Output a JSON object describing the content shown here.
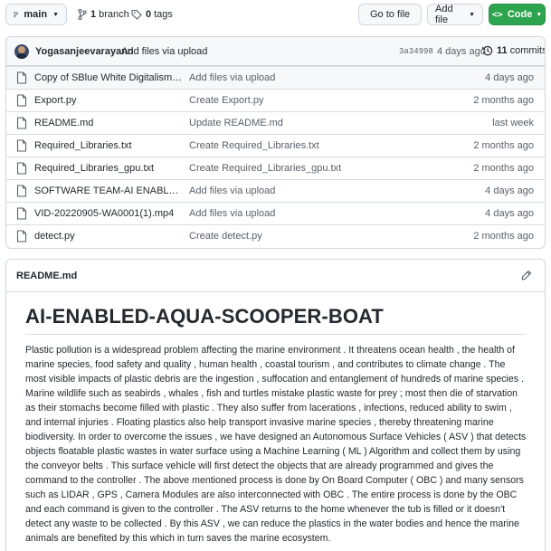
{
  "toolbar": {
    "branch": "main",
    "branches_count": "1",
    "branches_label": "branch",
    "tags_count": "0",
    "tags_label": "tags",
    "go_to_file": "Go to file",
    "add_file": "Add file",
    "code": "Code",
    "code_color": "#2da44e"
  },
  "latest_commit": {
    "author": "Yogasanjeevarayann",
    "message": "Add files via upload",
    "hash": "3a34998",
    "time": "4 days ago",
    "commits_count": "11",
    "commits_label": "commits"
  },
  "files": [
    {
      "name": "Copy of SBlue White Digitalism Basic ...",
      "commit": "Add files via upload",
      "age": "4 days ago",
      "icon": "file-icon"
    },
    {
      "name": "Export.py",
      "commit": "Create Export.py",
      "age": "2 months ago",
      "icon": "file-icon"
    },
    {
      "name": "README.md",
      "commit": "Update README.md",
      "age": "last week",
      "icon": "file-icon"
    },
    {
      "name": "Required_Libraries.txt",
      "commit": "Create Required_Libraries.txt",
      "age": "2 months ago",
      "icon": "file-icon"
    },
    {
      "name": "Required_Libraries_gpu.txt",
      "commit": "Create Required_Libraries_gpu.txt",
      "age": "2 months ago",
      "icon": "file-icon"
    },
    {
      "name": "SOFTWARE TEAM-AI ENABLED AQU...",
      "commit": "Add files via upload",
      "age": "4 days ago",
      "icon": "file-icon"
    },
    {
      "name": "VID-20220905-WA0001(1).mp4",
      "commit": "Add files via upload",
      "age": "4 days ago",
      "icon": "file-icon"
    },
    {
      "name": "detect.py",
      "commit": "Create detect.py",
      "age": "2 months ago",
      "icon": "file-icon"
    }
  ],
  "readme": {
    "filename": "README.md",
    "heading": "AI-ENABLED-AQUA-SCOOPER-BOAT",
    "body": "Plastic pollution is a widespread problem affecting the marine environment . It threatens ocean health , the health of marine species, food safety and quality , human health , coastal tourism , and contributes to climate change . The most visible impacts of plastic debris are the ingestion , suffocation and entanglement of hundreds of marine species . Marine wildlife such as seabirds , whales , fish and turtles mistake plastic waste for prey ; most then die of starvation as their stomachs become filled with plastic . They also suffer from lacerations , infections, reduced ability to swim , and internal injuries . Floating plastics also help transport invasive marine species , thereby threatening marine biodiversity. In order to overcome the issues , we have designed an Autonomous Surface Vehicles ( ASV ) that detects objects floatable plastic wastes in water surface using a Machine Learning ( ML ) Algorithm and collect them by using the conveyor belts . This surface vehicle will first detect the objects that are already programmed and gives the command to the controller . The above mentioned process is done by On Board Computer ( OBC ) and many sensors such as LIDAR , GPS , Camera Modules are also interconnected with OBC . The entire process is done by the OBC and each command is given to the controller . The ASV returns to the home whenever the tub is filled or it doesn't detect any waste to be collected . By this ASV , we can reduce the plastics in the water bodies and hence the marine animals are benefited by this which in turn saves the marine ecosystem."
  }
}
